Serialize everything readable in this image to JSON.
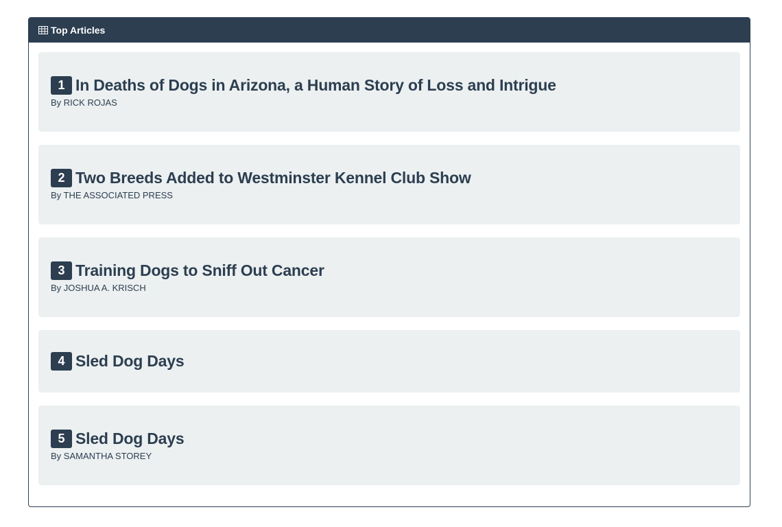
{
  "panel": {
    "heading": "Top Articles",
    "heading_icon": "table-icon"
  },
  "articles": [
    {
      "rank": "1",
      "title": "In Deaths of Dogs in Arizona, a Human Story of Loss and Intrigue",
      "byline": "By RICK ROJAS"
    },
    {
      "rank": "2",
      "title": "Two Breeds Added to Westminster Kennel Club Show",
      "byline": "By THE ASSOCIATED PRESS"
    },
    {
      "rank": "3",
      "title": "Training Dogs to Sniff Out Cancer",
      "byline": "By JOSHUA A. KRISCH"
    },
    {
      "rank": "4",
      "title": "Sled Dog Days",
      "byline": ""
    },
    {
      "rank": "5",
      "title": "Sled Dog Days",
      "byline": "By SAMANTHA STOREY"
    }
  ],
  "colors": {
    "header_bg": "#2c3e50",
    "card_bg": "#ecf0f1",
    "text": "#2c3e50"
  }
}
